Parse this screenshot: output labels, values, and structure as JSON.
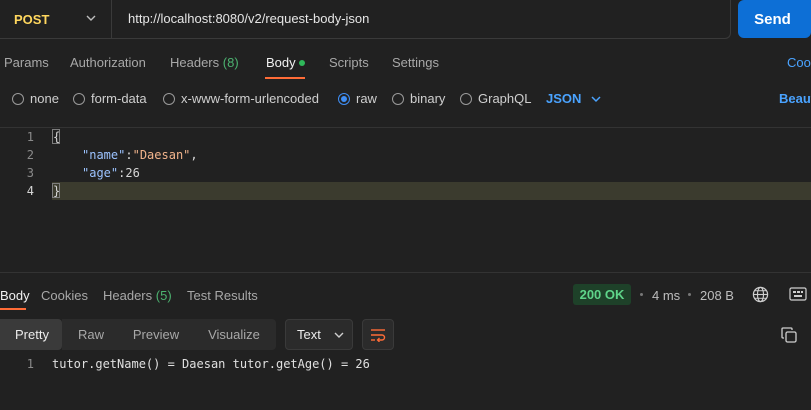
{
  "request": {
    "method": "POST",
    "url": "http://localhost:8080/v2/request-body-json",
    "send_label": "Send"
  },
  "tabs": {
    "params": "Params",
    "authorization": "Authorization",
    "headers_label": "Headers",
    "headers_count": "(8)",
    "body": "Body",
    "scripts": "Scripts",
    "settings": "Settings",
    "cookies": "Coo"
  },
  "body_types": {
    "none": "none",
    "form_data": "form-data",
    "urlencoded": "x-www-form-urlencoded",
    "raw": "raw",
    "binary": "binary",
    "graphql": "GraphQL",
    "selected": "raw",
    "format": "JSON",
    "beautify": "Beaut"
  },
  "editor": {
    "line_numbers": [
      "1",
      "2",
      "3",
      "4"
    ],
    "line1": "{",
    "key_name": "\"name\"",
    "val_name": "\"Daesan\"",
    "key_age": "\"age\"",
    "val_age": "26",
    "line4": "}"
  },
  "response": {
    "tabs": {
      "body": "Body",
      "cookies": "Cookies",
      "headers_label": "Headers",
      "headers_count": "(5)",
      "test_results": "Test Results"
    },
    "status": "200 OK",
    "time": "4 ms",
    "size": "208 B",
    "formats": {
      "pretty": "Pretty",
      "raw": "Raw",
      "preview": "Preview",
      "visualize": "Visualize"
    },
    "text_type": "Text",
    "line_number": "1",
    "content": "tutor.getName() = Daesan tutor.getAge() = 26"
  },
  "colors": {
    "accent_blue": "#0d6fd6",
    "method_yellow": "#ffd75e",
    "tab_orange": "#ff6c37",
    "status_green": "#5fd58a"
  }
}
